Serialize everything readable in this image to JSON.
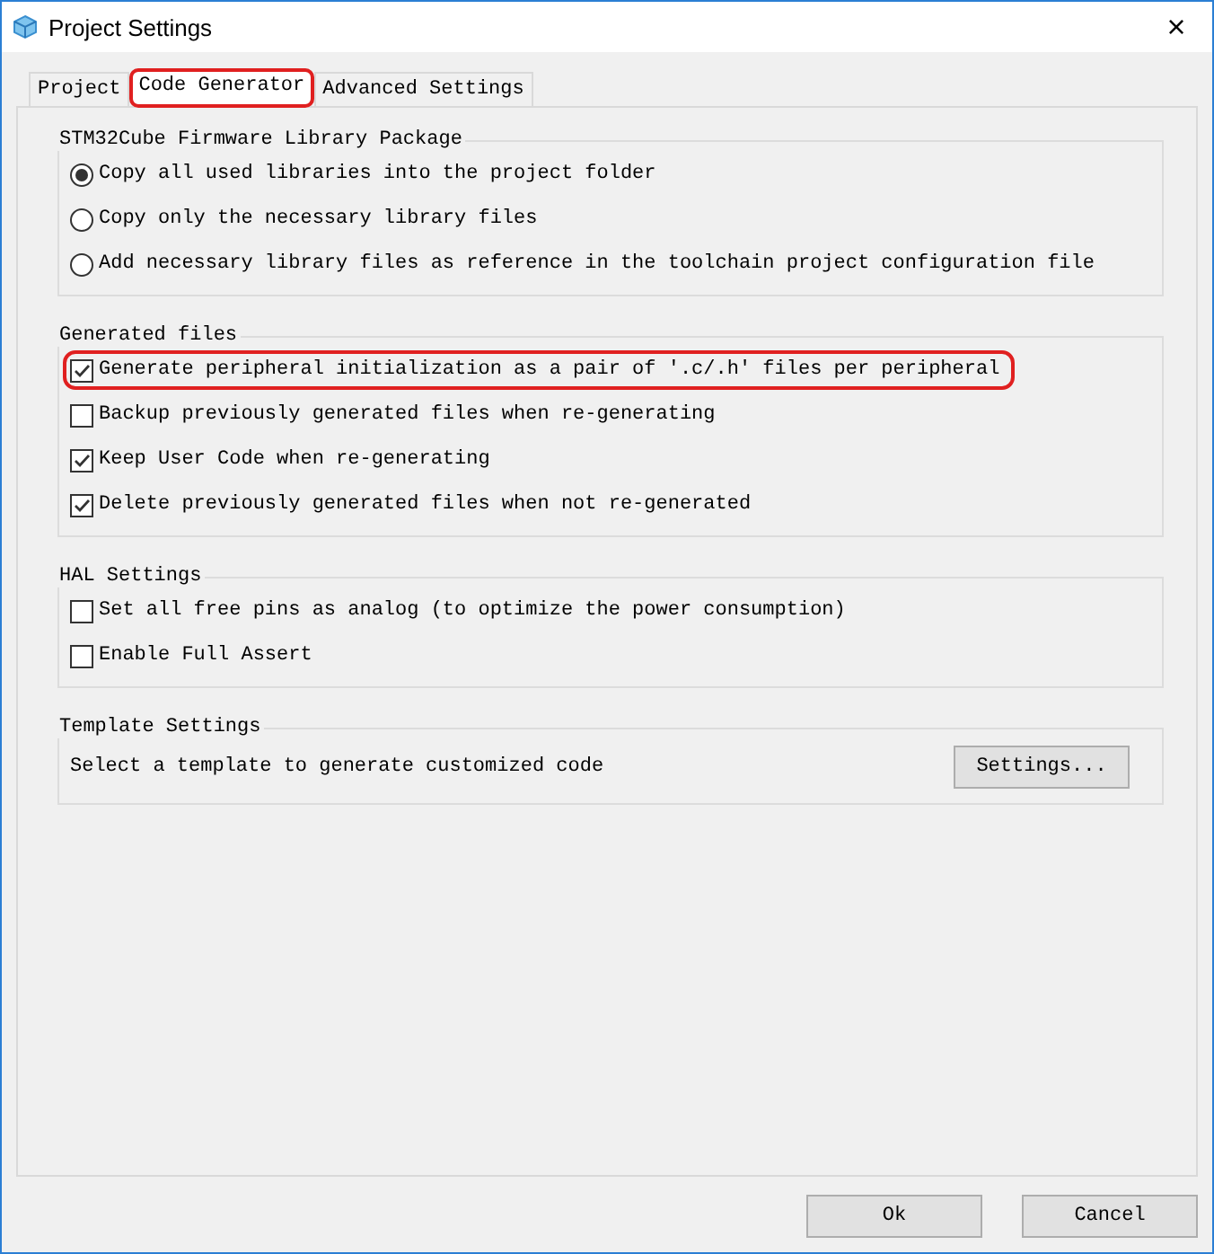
{
  "window": {
    "title": "Project Settings",
    "close": "×"
  },
  "tabs": [
    {
      "label": "Project",
      "selected": false,
      "highlighted": false
    },
    {
      "label": "Code Generator",
      "selected": true,
      "highlighted": true
    },
    {
      "label": "Advanced Settings",
      "selected": false,
      "highlighted": false
    }
  ],
  "groups": [
    {
      "title": "STM32Cube Firmware Library Package",
      "items": [
        {
          "kind": "radio",
          "label": "Copy all used libraries into the project folder",
          "selected": true,
          "highlighted": false
        },
        {
          "kind": "radio",
          "label": "Copy only the necessary library files",
          "selected": false,
          "highlighted": false
        },
        {
          "kind": "radio",
          "label": "Add necessary library files as reference in the toolchain project configuration file",
          "selected": false,
          "highlighted": false
        }
      ]
    },
    {
      "title": "Generated files",
      "items": [
        {
          "kind": "checkbox",
          "label": "Generate peripheral initialization as a pair of '.c/.h' files per peripheral",
          "checked": true,
          "highlighted": true
        },
        {
          "kind": "checkbox",
          "label": "Backup previously generated files when re-generating",
          "checked": false,
          "highlighted": false
        },
        {
          "kind": "checkbox",
          "label": "Keep User Code when re-generating",
          "checked": true,
          "highlighted": false
        },
        {
          "kind": "checkbox",
          "label": "Delete previously generated files when not re-generated",
          "checked": true,
          "highlighted": false
        }
      ]
    },
    {
      "title": "HAL Settings",
      "items": [
        {
          "kind": "checkbox",
          "label": "Set all free pins as analog (to optimize the power consumption)",
          "checked": false,
          "highlighted": false
        },
        {
          "kind": "checkbox",
          "label": "Enable Full Assert",
          "checked": false,
          "highlighted": false
        }
      ]
    },
    {
      "title": "Template Settings",
      "items": [
        {
          "kind": "action",
          "label": "Select a template to generate customized code",
          "button": "Settings..."
        }
      ]
    }
  ],
  "buttons": [
    "Ok",
    "Cancel"
  ]
}
